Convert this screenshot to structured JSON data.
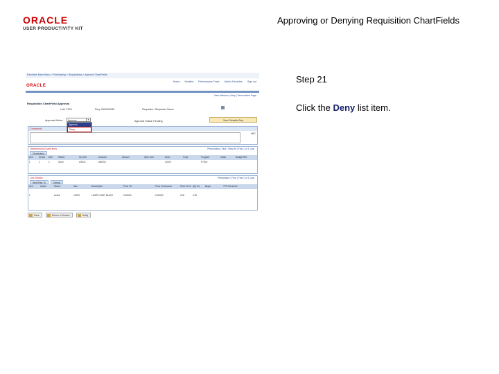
{
  "header": {
    "logo_word": "ORACLE",
    "logo_sub": "USER PRODUCTIVITY KIT",
    "slide_title": "Approving or Denying Requisition ChartFields"
  },
  "callout": {
    "step": "Step 21",
    "instruction_prefix": "Click the ",
    "instruction_bold": "Deny",
    "instruction_suffix": " list item."
  },
  "screen": {
    "breadcrumbs": "Favorites   Main Menu  > Purchasing > Requisitions > Approve ChartFields",
    "logo": "ORACLE",
    "nav_links": [
      "Home",
      "Worklist",
      "Performance Trace",
      "Add to Favorites",
      "Sign out"
    ],
    "page_links": "New Window | Help | Personalize Page",
    "page_title": "Requisition ChartField Approval",
    "unit_label": "Unit:  FS01",
    "req_label": "Req:  0000000081",
    "requester_label": "Requester:  Requester Name",
    "approval_action_label": "Approval Action:",
    "approval_action_value": "Approve",
    "dropdown_options": [
      "Approve",
      "Deny"
    ],
    "approval_status": "Approval Status:  Pending",
    "view_button": "View Printable Req",
    "comments_title": "Comments",
    "spell_check": "ABC",
    "dist_title": "Distributions/ChartFields",
    "dist_pager": "Personalize | Find | View All |  First  1 of 1  Last",
    "dist_tab": "Distribution",
    "dist_headers": [
      "Line",
      "Sched",
      "Dist",
      "Status",
      "GL Unit",
      "Account",
      "Alt Acct",
      "Oper Unit",
      "Dept",
      "Fund",
      "Program",
      "Class",
      "Budget Ref"
    ],
    "dist_row": [
      "1",
      "1",
      "1",
      "Open",
      "US001",
      "650000",
      "",
      "",
      "11000",
      "",
      "P7000",
      "",
      ""
    ],
    "line_title": "Line Details",
    "line_pager": "Personalize | Find |   First  1 of 1  Last",
    "line_tabs": [
      "Item/Ship To",
      "Details"
    ],
    "line_headers": [
      "Line",
      "Action",
      "Status",
      "Item",
      "Description",
      "Price Tol",
      "Price Tol Amount",
      "Price Tol %",
      "Qty Tol",
      "Buyer",
      "TPS Received"
    ],
    "line_row": [
      "1",
      "",
      "Active",
      "10005",
      "LASER CART BLACK",
      "0.00000",
      "0.00000",
      "0.00",
      "0.00",
      "",
      ""
    ],
    "bottom_buttons": [
      "Save",
      "Return to Search",
      "Notify"
    ]
  }
}
